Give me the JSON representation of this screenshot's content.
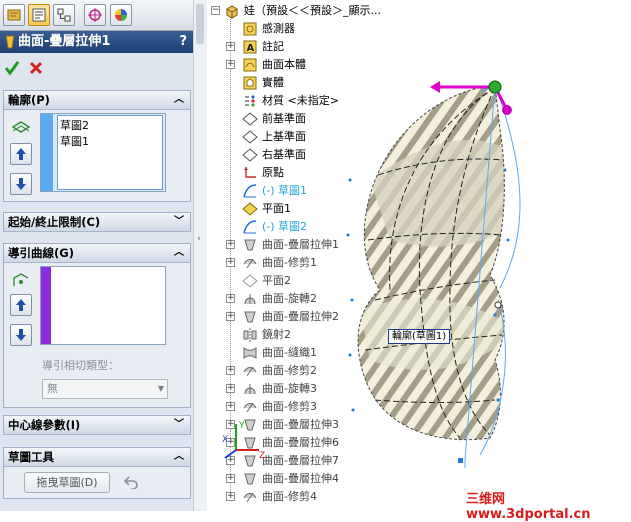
{
  "property_manager": {
    "title": "曲面-疊層拉伸1",
    "help": "?",
    "profile": {
      "header": "輪廓(P)",
      "items": [
        "草圖2",
        "草圖1"
      ]
    },
    "start_end": {
      "header": "起始/終止限制(C)"
    },
    "guide": {
      "header": "導引曲線(G)",
      "tangency_label": "導引相切類型：",
      "tangency_value": "無"
    },
    "centerline": {
      "header": "中心線參數(I)"
    },
    "sketch_tools": {
      "header": "草圖工具",
      "drag_button": "拖曳草圖(D)"
    }
  },
  "tree": {
    "root": "娃（預設＜＜預設＞_顯示...",
    "items": [
      {
        "label": "感測器",
        "icon": "sensor-icon",
        "expand": false,
        "style": "normal"
      },
      {
        "label": "註記",
        "icon": "annotation-icon",
        "expand": true,
        "style": "normal"
      },
      {
        "label": "曲面本體",
        "icon": "surface-body-icon",
        "expand": true,
        "style": "normal"
      },
      {
        "label": "實體",
        "icon": "solid-body-icon",
        "expand": false,
        "style": "normal"
      },
      {
        "label": "材質 <未指定>",
        "icon": "material-icon",
        "expand": false,
        "style": "normal"
      },
      {
        "label": "前基準面",
        "icon": "plane-icon",
        "expand": false,
        "style": "normal"
      },
      {
        "label": "上基準面",
        "icon": "plane-icon",
        "expand": false,
        "style": "normal"
      },
      {
        "label": "右基準面",
        "icon": "plane-icon",
        "expand": false,
        "style": "normal"
      },
      {
        "label": "原點",
        "icon": "origin-icon",
        "expand": false,
        "style": "normal"
      },
      {
        "label": "(-) 草圖1",
        "icon": "sketch-icon",
        "expand": false,
        "style": "blue"
      },
      {
        "label": "平面1",
        "icon": "plane-yellow-icon",
        "expand": false,
        "style": "normal"
      },
      {
        "label": "(-) 草圖2",
        "icon": "sketch-icon",
        "expand": false,
        "style": "blue"
      },
      {
        "label": "曲面-疊層拉伸1",
        "icon": "loft-icon",
        "expand": true,
        "style": "dim"
      },
      {
        "label": "曲面-修剪1",
        "icon": "trim-icon",
        "expand": true,
        "style": "dim"
      },
      {
        "label": "平面2",
        "icon": "plane-gray-icon",
        "expand": false,
        "style": "dim"
      },
      {
        "label": "曲面-旋轉2",
        "icon": "revolve-icon",
        "expand": true,
        "style": "dim"
      },
      {
        "label": "曲面-疊層拉伸2",
        "icon": "loft-icon",
        "expand": true,
        "style": "dim"
      },
      {
        "label": "鏡射2",
        "icon": "mirror-icon",
        "expand": false,
        "style": "dim"
      },
      {
        "label": "曲面-縫織1",
        "icon": "knit-icon",
        "expand": false,
        "style": "dim"
      },
      {
        "label": "曲面-修剪2",
        "icon": "trim-icon",
        "expand": true,
        "style": "dim"
      },
      {
        "label": "曲面-旋轉3",
        "icon": "revolve-icon",
        "expand": true,
        "style": "dim"
      },
      {
        "label": "曲面-修剪3",
        "icon": "trim-icon",
        "expand": true,
        "style": "dim"
      },
      {
        "label": "曲面-疊層拉伸3",
        "icon": "loft-icon",
        "expand": true,
        "style": "dim"
      },
      {
        "label": "曲面-疊層拉伸6",
        "icon": "loft-icon",
        "expand": true,
        "style": "dim"
      },
      {
        "label": "曲面-疊層拉伸7",
        "icon": "loft-icon",
        "expand": true,
        "style": "dim"
      },
      {
        "label": "曲面-疊層拉伸4",
        "icon": "loft-icon",
        "expand": true,
        "style": "dim"
      },
      {
        "label": "曲面-修剪4",
        "icon": "trim-icon",
        "expand": true,
        "style": "dim"
      }
    ]
  },
  "viewport": {
    "profile_tag": "輪廓(草圖1)"
  },
  "watermark": "三维网 www.3dportal.cn",
  "colors": {
    "title_bar": "#2a4d82",
    "accent_blue": "#5aaaf0",
    "guide_purple": "#8a2be2",
    "handle_magenta": "#e000c8",
    "handle_green": "#2eaa2e"
  }
}
